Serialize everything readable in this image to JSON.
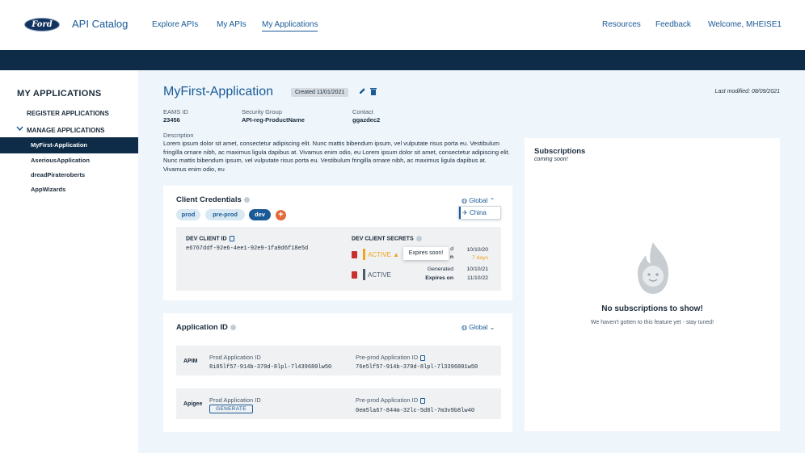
{
  "brand": {
    "logo_text": "Ford",
    "title": "API Catalog"
  },
  "nav": {
    "explore": "Explore APIs",
    "my_apis": "My APIs",
    "my_applications": "My Applications",
    "resources": "Resources",
    "feedback": "Feedback",
    "welcome": "Welcome, MHEISE1"
  },
  "sidebar": {
    "title": "MY APPLICATIONS",
    "register": "REGISTER APPLICATIONS",
    "manage": "MANAGE APPLICATIONS",
    "items": [
      "MyFirst-Application",
      "AseriousApplication",
      "dreadPirateroberts",
      "AppWizards"
    ]
  },
  "app": {
    "name": "MyFirst-Application",
    "created": "Created 11/01/2021",
    "last_modified": "Last modified: 08/09/2021",
    "eams_label": "EAMS ID",
    "eams_value": "23456",
    "security_label": "Security Group",
    "security_value": "API-reg-ProductName",
    "contact_label": "Contact",
    "contact_value": "ggazdec2",
    "description_label": "Description",
    "description": "Lorem ipsum dolor sit amet, consectetur adipiscing elit. Nunc mattis bibendum ipsum, vel vulputate risus porta eu. Vestibulum fringilla ornare nibh, ac maximus ligula dapibus at. Vivamus enim odio, eu Lorem ipsum dolor sit amet, consectetur adipiscing elit. Nunc mattis bibendum ipsum, vel vulputate risus porta eu. Vestibulum fringilla ornare nibh, ac maximus ligula dapibus at. Vivamus enim odio, eu"
  },
  "credentials": {
    "title": "Client Credentials",
    "envs": [
      "prod",
      "pre-prod",
      "dev"
    ],
    "selected_env": "dev",
    "region": "Global",
    "region_option": "China",
    "client_id_label": "DEV CLIENT ID",
    "client_id": "e6767ddf-92e6-4ee1-92e9-1fa9d6f18e5d",
    "secrets_label": "DEV CLIENT SECRETS",
    "secret1": {
      "status": "ACTIVE",
      "date_right": "10/10/20",
      "expires_in": "7 days",
      "partial_label_1": "d",
      "partial_label_2": "n"
    },
    "tooltip": "Expires soon!",
    "secret2": {
      "status": "ACTIVE",
      "generated_label": "Generated",
      "generated": "10/10/21",
      "expires_label": "Expires on",
      "expires": "11/10/22"
    }
  },
  "application_id": {
    "title": "Application ID",
    "region": "Global",
    "rows": [
      {
        "name": "APIM",
        "prod_label": "Prod Application ID",
        "prod_value": "8i05lf57-914b-370d-8lpl-7l439680lw50",
        "pre_label": "Pre-prod Application ID",
        "pre_value": "76e5lf57-914b-370d-8lpl-7l3396801w50"
      },
      {
        "name": "Apigee",
        "prod_label": "Prod Application ID",
        "generate": "GENERATE",
        "pre_label": "Pre-prod Application ID",
        "pre_value": "0em5la67-844m-32lc-5d8l-7m3v9b8lw40"
      }
    ]
  },
  "subscriptions": {
    "title": "Subscriptions",
    "soon": "coming soon!",
    "empty_title": "No subscriptions to show!",
    "empty_sub": "We haven't gotten to this feature yet - stay tuned!"
  },
  "colors": {
    "navy": "#0e2c47",
    "link": "#1a5a96",
    "active_orange": "#f0a41c",
    "danger": "#c9302c",
    "accent": "#e36b3b"
  }
}
